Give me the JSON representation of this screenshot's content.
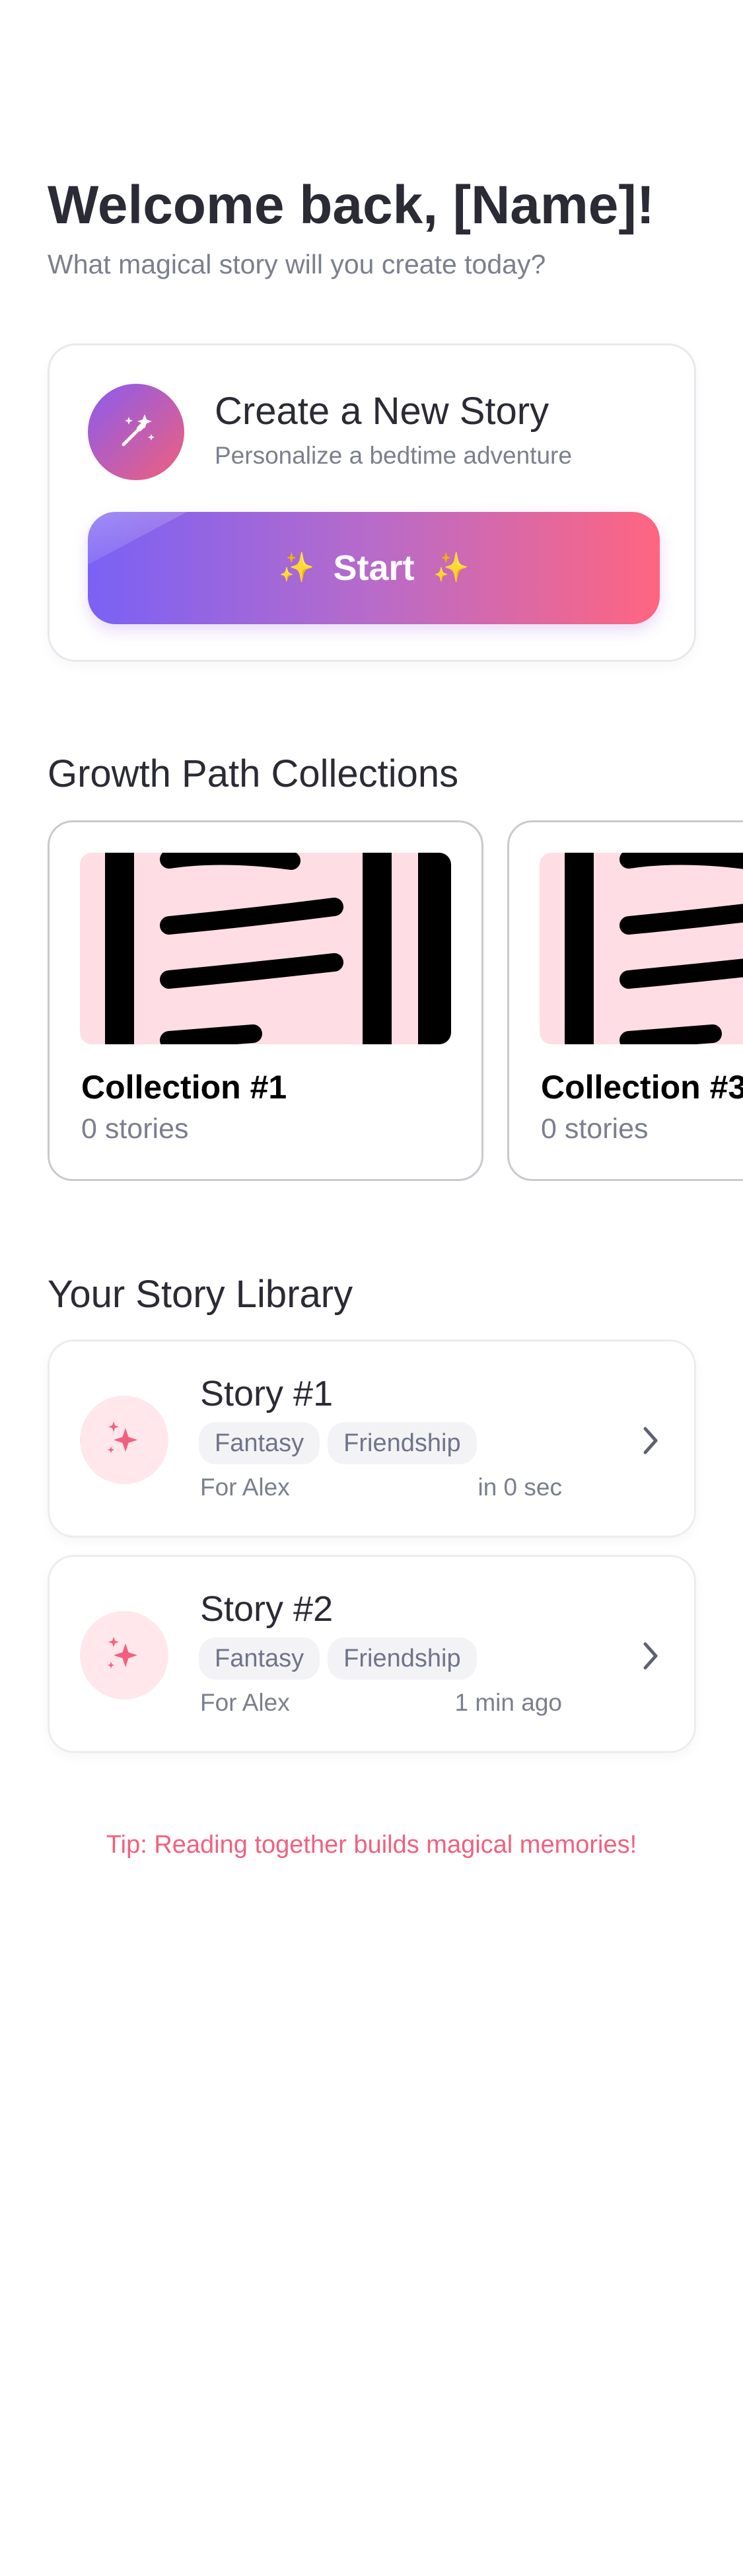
{
  "header": {
    "title": "Welcome back, [Name]!",
    "subtitle": "What magical story will you create today?"
  },
  "create_card": {
    "icon": "magic-wand-icon",
    "title": "Create a New Story",
    "subtitle": "Personalize a bedtime adventure",
    "start_label": "Start",
    "sparkle_glyph": "✨"
  },
  "collections": {
    "title": "Growth Path Collections",
    "items": [
      {
        "name": "Collection #1",
        "count": "0 stories"
      },
      {
        "name": "Collection #3",
        "count": "0 stories"
      }
    ]
  },
  "library": {
    "title": "Your Story Library",
    "stories": [
      {
        "title": "Story #1",
        "tags": [
          "Fantasy",
          "Friendship"
        ],
        "for": "For Alex",
        "time": "in 0 sec"
      },
      {
        "title": "Story #2",
        "tags": [
          "Fantasy",
          "Friendship"
        ],
        "for": "For Alex",
        "time": "1 min ago"
      }
    ]
  },
  "tip": "Tip: Reading together builds magical memories!",
  "colors": {
    "accent_purple": "#7a61f5",
    "accent_pink": "#ff6580",
    "tip_pink": "#f3607e",
    "thumb_pink": "#ffdde4"
  }
}
